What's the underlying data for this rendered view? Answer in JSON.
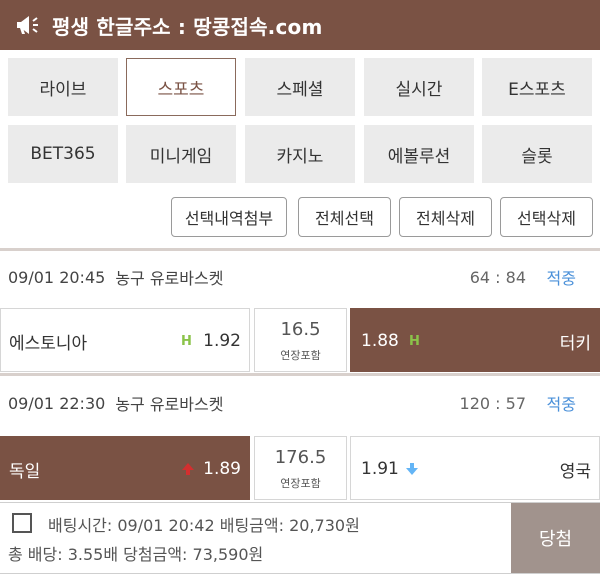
{
  "banner": {
    "title": "평생 한글주소 : 땅콩접속.com",
    "icon": "megaphone-icon"
  },
  "categories": {
    "row1": [
      "라이브",
      "스포츠",
      "스페셜",
      "실시간",
      "E스포츠"
    ],
    "row2": [
      "BET365",
      "미니게임",
      "카지노",
      "에볼루션",
      "슬롯"
    ],
    "active": "스포츠"
  },
  "actions": [
    "선택내역첨부",
    "전체선택",
    "전체삭제",
    "선택삭제"
  ],
  "matches": [
    {
      "datetime": "09/01 20:45",
      "league": "농구 유로바스켓",
      "score": "64 : 84",
      "result": "적중",
      "home": {
        "team": "에스토니아",
        "mark": "H",
        "odds": "1.92"
      },
      "handicap": {
        "value": "16.5",
        "sub": "연장포함"
      },
      "away": {
        "team": "터키",
        "mark": "H",
        "odds": "1.88",
        "selected": true
      }
    },
    {
      "datetime": "09/01 22:30",
      "league": "농구 유로바스켓",
      "score": "120 : 57",
      "result": "적중",
      "home": {
        "team": "독일",
        "mark": "up-arrow",
        "odds": "1.89",
        "selected": true
      },
      "total": {
        "value": "176.5",
        "sub": "연장포함"
      },
      "away": {
        "team": "영국",
        "mark": "down-arrow",
        "odds": "1.91"
      }
    }
  ],
  "bet": {
    "line1": "배팅시간: 09/01 20:42  배팅금액: 20,730원",
    "line2": "총 배당: 3.55배  당첨금액: 73,590원",
    "status": "당첨"
  },
  "colors": {
    "brand": "#7a5244",
    "hit": "#4a90d9",
    "home_mark": "#8bc34a",
    "up": "#d32f2f",
    "down": "#64b5f6"
  }
}
